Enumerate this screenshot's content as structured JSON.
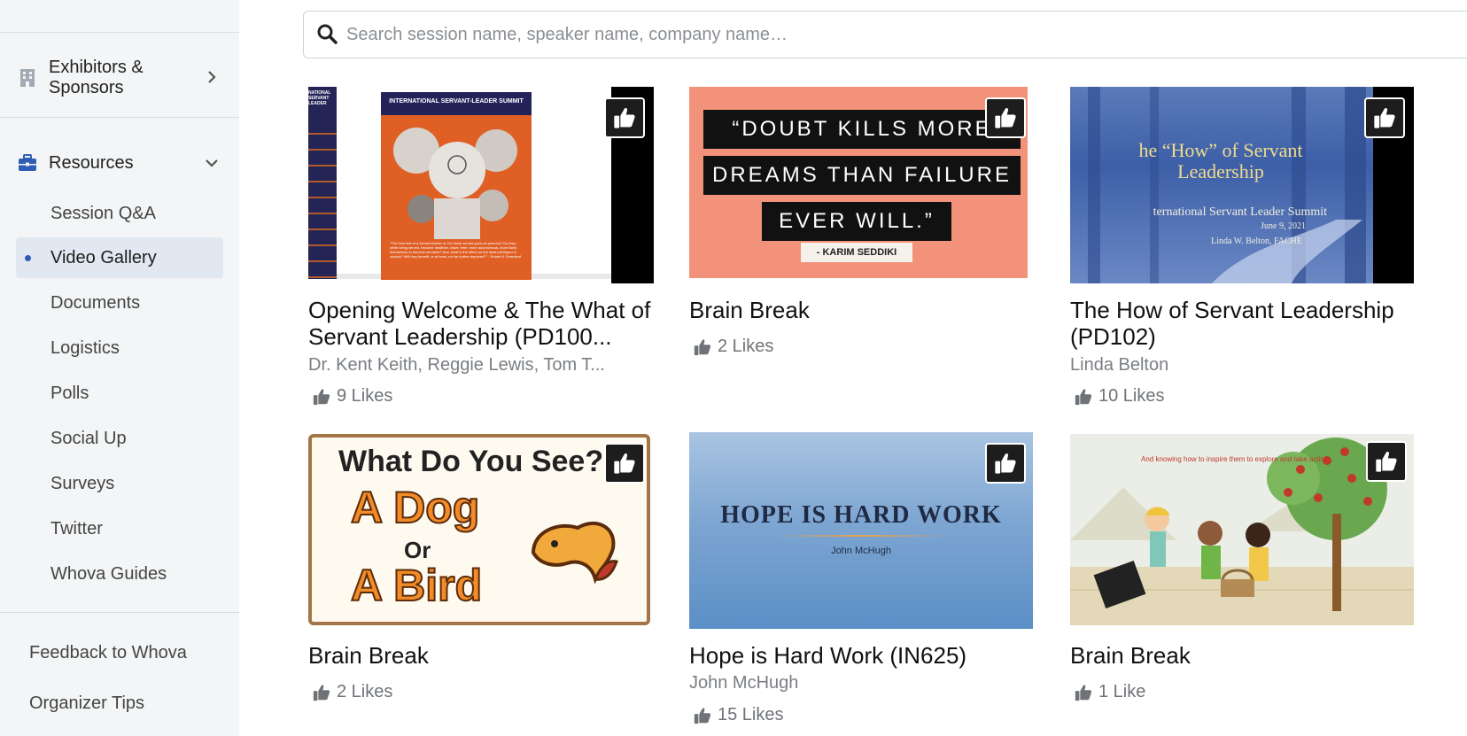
{
  "sidebar": {
    "exhibitors": {
      "label_line1": "Exhibitors &",
      "label_line2": "Sponsors",
      "icon": "building-icon"
    },
    "resources": {
      "label": "Resources",
      "icon": "toolbox-icon"
    },
    "items": [
      {
        "label": "Session Q&A"
      },
      {
        "label": "Video Gallery",
        "active": true
      },
      {
        "label": "Documents"
      },
      {
        "label": "Logistics"
      },
      {
        "label": "Polls"
      },
      {
        "label": "Social Up"
      },
      {
        "label": "Surveys"
      },
      {
        "label": "Twitter"
      },
      {
        "label": "Whova Guides"
      }
    ],
    "footer": [
      {
        "label": "Feedback to Whova"
      },
      {
        "label": "Organizer Tips"
      }
    ]
  },
  "search": {
    "placeholder": "Search session name, speaker name, company name…"
  },
  "videos": [
    {
      "title": "Opening Welcome & The What of Servant Leadership (PD100...",
      "speakers": "Dr. Kent Keith, Reggie Lewis, Tom T...",
      "likes": "9 Likes",
      "thumb": {
        "header": "INTERNATIONAL SERVANT-LEADER SUMMIT",
        "side_label": "NATIONAL SERVANT LEADER",
        "quote": "\"The best test of a servant-leader is: Do those served grow as persons? Do they, while being served, become healthier, wiser, freer, more autonomous, more likely themselves to become servants? And, what is the effect on the least privileged in society? Will they benefit, or at least, not be further deprived?\" - Robert K Greenleaf"
      }
    },
    {
      "title": "Brain Break",
      "speakers": "",
      "likes": "2 Likes",
      "thumb": {
        "line1": "“DOUBT KILLS MORE",
        "line2": "DREAMS THAN FAILURE",
        "line3": "EVER WILL.”",
        "author": "- KARIM SEDDIKI"
      }
    },
    {
      "title": "The How of Servant Leadership (PD102)",
      "speakers": "Linda Belton",
      "likes": "10 Likes",
      "thumb": {
        "line1": "he “How” of Servant",
        "line2": "Leadership",
        "line3": "ternational Servant Leader Summit",
        "line4": "June 9, 2021",
        "line5": "Linda W. Belton, FACHE"
      }
    },
    {
      "title": "Brain Break",
      "speakers": "",
      "likes": "2 Likes",
      "thumb": {
        "line1": "What Do You See?",
        "line2": "A Dog",
        "line3": "Or",
        "line4": "A Bird"
      }
    },
    {
      "title": "Hope is Hard Work (IN625)",
      "speakers": "John McHugh",
      "likes": "15 Likes",
      "thumb": {
        "line1": "HOPE IS HARD WORK",
        "line2": "John McHugh"
      }
    },
    {
      "title": "Brain Break",
      "speakers": "",
      "likes": "1 Like",
      "thumb": {
        "caption": "And knowing how to inspire them to explore and take action"
      }
    }
  ]
}
